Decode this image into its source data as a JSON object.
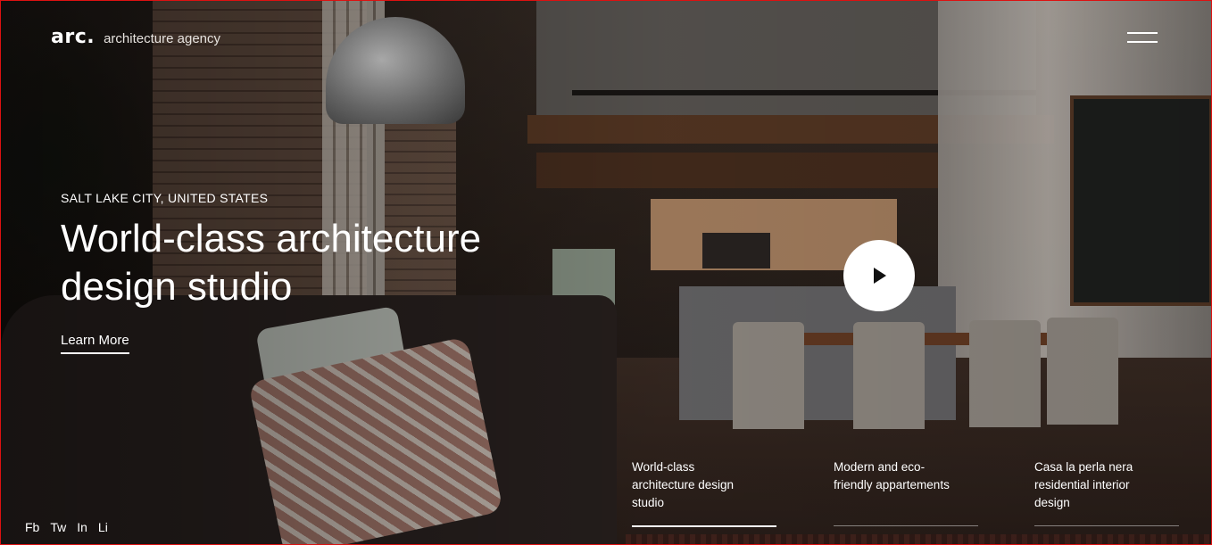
{
  "header": {
    "logo_mark": "arc.",
    "logo_tagline": "architecture agency",
    "menu_icon": "hamburger-menu-icon"
  },
  "hero": {
    "location": "SALT LAKE CITY, UNITED STATES",
    "headline_line1": "World-class architecture",
    "headline_line2": "design studio",
    "cta_label": "Learn More"
  },
  "video": {
    "play_icon": "play-icon"
  },
  "slides": [
    {
      "lines": [
        "World-class",
        "architecture design",
        "studio"
      ],
      "active": true
    },
    {
      "lines": [
        "Modern and eco-",
        "friendly appartements"
      ],
      "active": false
    },
    {
      "lines": [
        "Casa la perla nera",
        "residential interior",
        "design"
      ],
      "active": false
    }
  ],
  "social": [
    "Fb",
    "Tw",
    "In",
    "Li"
  ],
  "colors": {
    "text": "#ffffff",
    "frame_border": "#dd1111",
    "play_button_bg": "#ffffff"
  }
}
